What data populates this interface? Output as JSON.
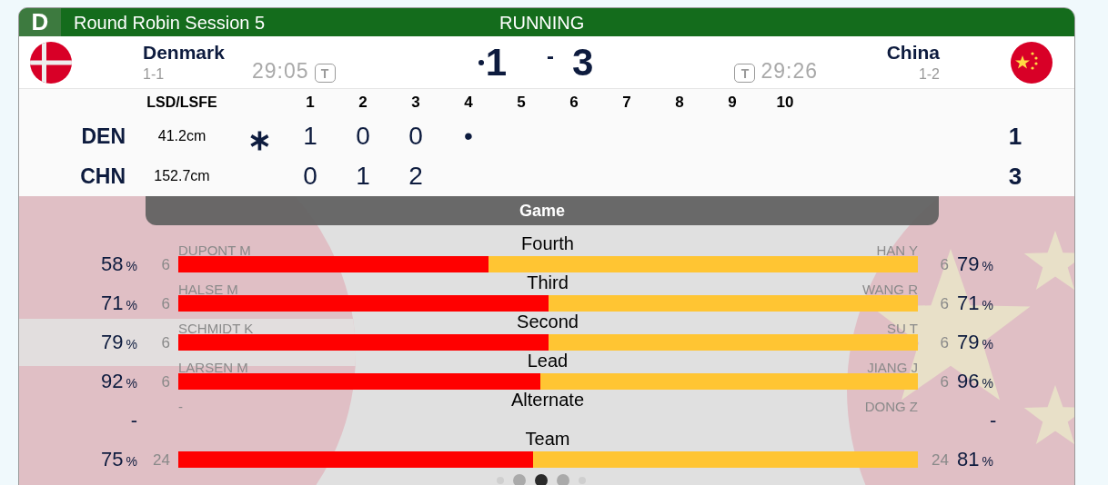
{
  "header": {
    "badge": "D",
    "title": "Round Robin Session 5",
    "status": "RUNNING"
  },
  "teams": [
    {
      "kind": "denmark",
      "name": "Denmark",
      "record": "1-1",
      "clock": "29:05",
      "timeout": "T",
      "score": "1",
      "hammer": true
    },
    {
      "kind": "china",
      "name": "China",
      "record": "1-2",
      "clock": "29:26",
      "timeout": "T",
      "score": "3",
      "hammer": false
    }
  ],
  "score_separator": "-",
  "ends": {
    "columns": [
      "LSD/LSFE",
      "1",
      "2",
      "3",
      "4",
      "5",
      "6",
      "7",
      "8",
      "9",
      "10"
    ],
    "rows": [
      {
        "team": "DEN",
        "lsd": "41.2cm",
        "first_hammer": "∗",
        "ends": [
          "1",
          "0",
          "0",
          "•"
        ],
        "total": "1"
      },
      {
        "team": "CHN",
        "lsd": "152.7cm",
        "ends": [
          "0",
          "1",
          "2"
        ],
        "total": "3"
      }
    ]
  },
  "stats": {
    "tab": "Game",
    "rows": [
      {
        "position": "Fourth",
        "level": 0.42,
        "left": {
          "name": "DUPONT M",
          "count": "6",
          "pct": "58",
          "unit": "%"
        },
        "right": {
          "name": "HAN Y",
          "count": "6",
          "pct": "79",
          "unit": "%"
        }
      },
      {
        "position": "Third",
        "level": 0.5,
        "left": {
          "name": "HALSE M",
          "count": "6",
          "pct": "71",
          "unit": "%"
        },
        "right": {
          "name": "WANG R",
          "count": "6",
          "pct": "71",
          "unit": "%"
        }
      },
      {
        "position": "Second",
        "level": 0.5,
        "left": {
          "name": "SCHMIDT K",
          "count": "6",
          "pct": "79",
          "unit": "%"
        },
        "right": {
          "name": "SU T",
          "count": "6",
          "pct": "79",
          "unit": "%"
        }
      },
      {
        "position": "Lead",
        "level": 0.49,
        "left": {
          "name": "LARSEN M",
          "count": "6",
          "pct": "92",
          "unit": "%"
        },
        "right": {
          "name": "JIANG J",
          "count": "6",
          "pct": "96",
          "unit": "%"
        }
      },
      {
        "position": "Alternate",
        "left": {
          "name": "-",
          "pct": "-"
        },
        "right": {
          "name": "DONG Z",
          "pct": "-"
        }
      },
      {
        "position": "Team",
        "level": 0.48,
        "left": {
          "count": "24",
          "pct": "75",
          "unit": "%"
        },
        "right": {
          "count": "24",
          "pct": "81",
          "unit": "%"
        }
      }
    ]
  },
  "pager": [
    {
      "kind": "small",
      "selected": false
    },
    {
      "kind": "medium",
      "selected": false
    },
    {
      "kind": "medium",
      "selected": true
    },
    {
      "kind": "medium",
      "selected": false
    },
    {
      "kind": "small",
      "selected": false
    }
  ]
}
